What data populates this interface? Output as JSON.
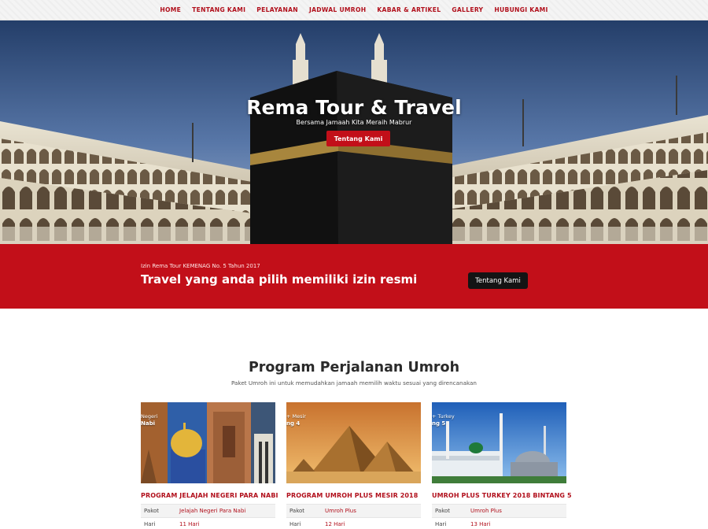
{
  "nav": {
    "items": [
      "HOME",
      "TENTANG KAMI",
      "PELAYANAN",
      "JADWAL UMROH",
      "KABAR & ARTIKEL",
      "GALLERY",
      "HUBUNGI KAMI"
    ]
  },
  "hero": {
    "title": "Rema Tour & Travel",
    "subtitle": "Bersama Jamaah Kita Meraih Mabrur",
    "button_label": "Tentang Kami"
  },
  "banner": {
    "small_text": "Izin Rema Tour KEMENAG No. 5 Tahun 2017",
    "title": "Travel yang anda pilih memiliki izin resmi",
    "button_label": "Tentang Kami"
  },
  "section": {
    "title": "Program Perjalanan Umroh",
    "subtitle": "Paket Umroh ini untuk memudahkan jamaah memilih waktu sesuai yang direncanakan"
  },
  "cards": [
    {
      "ribbon_line1": "Negeri",
      "ribbon_line2": "Nabi",
      "title": "PROGRAM JELAJAH NEGERI PARA NABI",
      "rows": [
        {
          "label": "Pakot",
          "value": "Jelajah Negeri Para Nabi"
        },
        {
          "label": "Hari",
          "value": "11 Hari"
        }
      ]
    },
    {
      "ribbon_line1": "+ Mesir",
      "ribbon_line2": "ng 4",
      "title": "PROGRAM UMROH PLUS MESIR 2018",
      "rows": [
        {
          "label": "Pakot",
          "value": "Umroh Plus"
        },
        {
          "label": "Hari",
          "value": "12 Hari"
        }
      ]
    },
    {
      "ribbon_line1": "+ Turkey",
      "ribbon_line2": "ng 5",
      "title": "UMROH PLUS TURKEY 2018 BINTANG 5",
      "rows": [
        {
          "label": "Pakot",
          "value": "Umroh Plus"
        },
        {
          "label": "Hari",
          "value": "13 Hari"
        }
      ]
    }
  ],
  "colors": {
    "brand_red": "#c20f19",
    "nav_text": "#b10f1b",
    "dark_button": "#141414"
  }
}
